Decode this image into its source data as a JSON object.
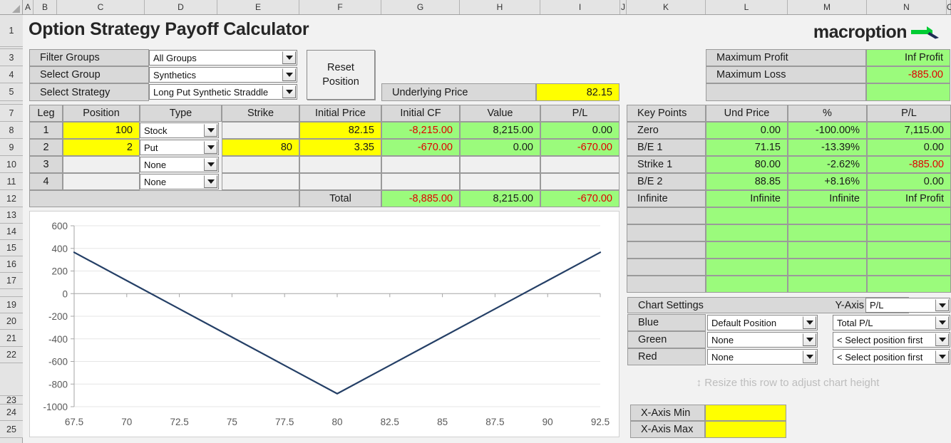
{
  "app": {
    "title": "Option Strategy Payoff Calculator",
    "brand": "macroption"
  },
  "spreadsheet": {
    "columns": [
      "A",
      "B",
      "C",
      "D",
      "E",
      "F",
      "G",
      "H",
      "I",
      "J",
      "K",
      "L",
      "M",
      "N",
      "O"
    ],
    "rows": [
      "1",
      "3",
      "4",
      "5",
      "7",
      "8",
      "9",
      "10",
      "11",
      "12",
      "13",
      "14",
      "15",
      "16",
      "17",
      "19",
      "20",
      "21",
      "22",
      "23",
      "24",
      "25"
    ]
  },
  "selectors": {
    "filter_groups_label": "Filter Groups",
    "filter_groups_value": "All Groups",
    "select_group_label": "Select Group",
    "select_group_value": "Synthetics",
    "select_strategy_label": "Select Strategy",
    "select_strategy_value": "Long Put Synthetic Straddle",
    "reset_button": "Reset\nPosition",
    "reset_button_line1": "Reset",
    "reset_button_line2": "Position"
  },
  "underlying": {
    "label": "Underlying Price",
    "value": "82.15"
  },
  "maxima": {
    "max_profit_label": "Maximum Profit",
    "max_profit_value": "Inf Profit",
    "max_loss_label": "Maximum Loss",
    "max_loss_value": "-885.00"
  },
  "legs_table": {
    "headers": [
      "Leg",
      "Position",
      "Type",
      "Strike",
      "Initial Price",
      "Initial CF",
      "Value",
      "P/L"
    ],
    "rows": [
      {
        "leg": "1",
        "position": "100",
        "type": "Stock",
        "strike": "",
        "initial_price": "82.15",
        "initial_cf": "-8,215.00",
        "value": "8,215.00",
        "pl": "0.00"
      },
      {
        "leg": "2",
        "position": "2",
        "type": "Put",
        "strike": "80",
        "initial_price": "3.35",
        "initial_cf": "-670.00",
        "value": "0.00",
        "pl": "-670.00"
      },
      {
        "leg": "3",
        "position": "",
        "type": "None",
        "strike": "",
        "initial_price": "",
        "initial_cf": "",
        "value": "",
        "pl": ""
      },
      {
        "leg": "4",
        "position": "",
        "type": "None",
        "strike": "",
        "initial_price": "",
        "initial_cf": "",
        "value": "",
        "pl": ""
      }
    ],
    "total_label": "Total",
    "total_initial_cf": "-8,885.00",
    "total_value": "8,215.00",
    "total_pl": "-670.00"
  },
  "key_points": {
    "headers": [
      "Key Points",
      "Und Price",
      "%",
      "P/L"
    ],
    "rows": [
      {
        "name": "Zero",
        "und_price": "0.00",
        "pct": "-100.00%",
        "pl": "7,115.00"
      },
      {
        "name": "B/E 1",
        "und_price": "71.15",
        "pct": "-13.39%",
        "pl": "0.00"
      },
      {
        "name": "Strike 1",
        "und_price": "80.00",
        "pct": "-2.62%",
        "pl": "-885.00"
      },
      {
        "name": "B/E 2",
        "und_price": "88.85",
        "pct": "+8.16%",
        "pl": "0.00"
      },
      {
        "name": "Infinite",
        "und_price": "Infinite",
        "pct": "Infinite",
        "pl": "Inf Profit"
      },
      {
        "name": "",
        "und_price": "",
        "pct": "",
        "pl": ""
      },
      {
        "name": "",
        "und_price": "",
        "pct": "",
        "pl": ""
      },
      {
        "name": "",
        "und_price": "",
        "pct": "",
        "pl": ""
      },
      {
        "name": "",
        "und_price": "",
        "pct": "",
        "pl": ""
      },
      {
        "name": "",
        "und_price": "",
        "pct": "",
        "pl": ""
      }
    ]
  },
  "chart_settings": {
    "title": "Chart Settings",
    "y_axis_label": "Y-Axis",
    "y_axis_value": "P/L",
    "series": [
      {
        "color_label": "Blue",
        "position": "Default Position",
        "metric": "Total P/L"
      },
      {
        "color_label": "Green",
        "position": "None",
        "metric": "< Select position first"
      },
      {
        "color_label": "Red",
        "position": "None",
        "metric": "< Select position first"
      }
    ],
    "resize_hint": "Resize this row to adjust chart height",
    "x_axis_min_label": "X-Axis Min",
    "x_axis_min_value": "",
    "x_axis_max_label": "X-Axis Max",
    "x_axis_max_value": ""
  },
  "chart_data": {
    "type": "line",
    "title": "",
    "xlabel": "",
    "ylabel": "",
    "xlim": [
      67.5,
      92.5
    ],
    "ylim": [
      -1000,
      600
    ],
    "xticks": [
      "67.5",
      "70",
      "72.5",
      "75",
      "77.5",
      "80",
      "82.5",
      "85",
      "87.5",
      "90",
      "92.5"
    ],
    "yticks": [
      "600",
      "400",
      "200",
      "0",
      "-200",
      "-400",
      "-600",
      "-800",
      "-1000"
    ],
    "grid": true,
    "legend": "none",
    "series": [
      {
        "name": "Total P/L",
        "color": "#243f66",
        "x": [
          67.5,
          70,
          72.5,
          75,
          77.5,
          80,
          82.5,
          85,
          87.5,
          90,
          92.5
        ],
        "y": [
          365,
          115,
          -135,
          -385,
          -635,
          -885,
          -635,
          -385,
          -135,
          115,
          365
        ]
      }
    ]
  },
  "colors": {
    "accent_green": "#9bfb7c",
    "input_yellow": "#ffff00",
    "negative_red": "#e00000",
    "series_blue": "#243f66",
    "brand_green": "#00cc33",
    "brand_navy": "#1f2d55"
  }
}
